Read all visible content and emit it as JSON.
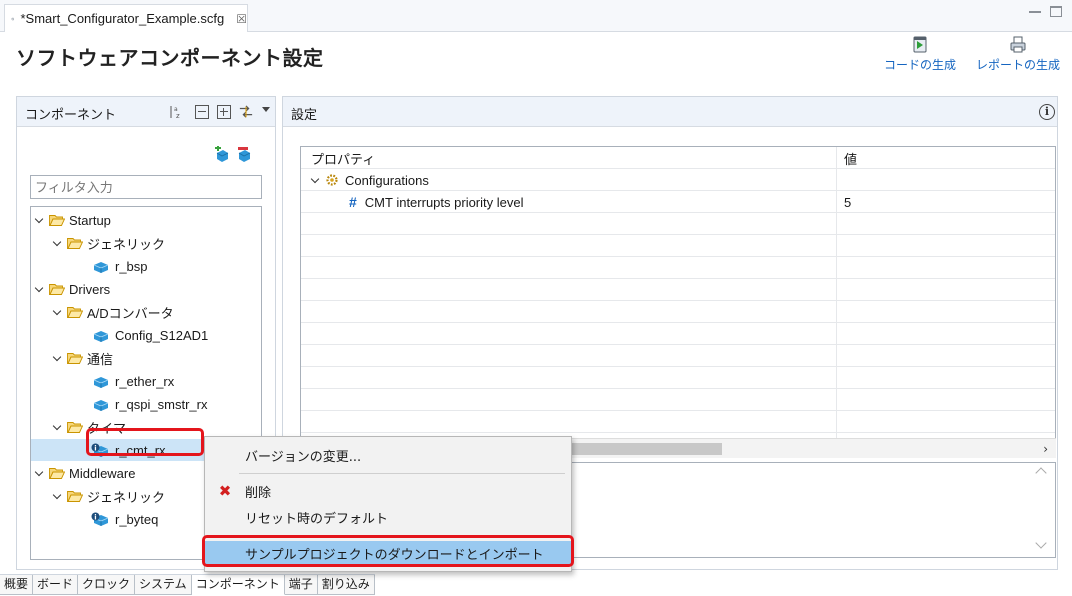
{
  "editor_tab": {
    "label": "*Smart_Configurator_Example.scfg",
    "close": "☒"
  },
  "page_title": "ソフトウェアコンポーネント設定",
  "header_buttons": {
    "code_gen": "コードの生成",
    "report_gen": "レポートの生成"
  },
  "left_pane": {
    "title": "コンポーネント",
    "filter_placeholder": "フィルタ入力",
    "tree": [
      {
        "label": "Startup",
        "kind": "folder",
        "level": 0
      },
      {
        "label": "ジェネリック",
        "kind": "folder",
        "level": 1
      },
      {
        "label": "r_bsp",
        "kind": "component",
        "level": 2
      },
      {
        "label": "Drivers",
        "kind": "folder",
        "level": 0
      },
      {
        "label": "A/Dコンバータ",
        "kind": "folder",
        "level": 1
      },
      {
        "label": "Config_S12AD1",
        "kind": "component",
        "level": 2
      },
      {
        "label": "通信",
        "kind": "folder",
        "level": 1
      },
      {
        "label": "r_ether_rx",
        "kind": "component",
        "level": 2
      },
      {
        "label": "r_qspi_smstr_rx",
        "kind": "component",
        "level": 2
      },
      {
        "label": "タイマ",
        "kind": "folder",
        "level": 1
      },
      {
        "label": "r_cmt_rx",
        "kind": "component",
        "level": 2,
        "selected": true
      },
      {
        "label": "Middleware",
        "kind": "folder",
        "level": 0
      },
      {
        "label": "ジェネリック",
        "kind": "folder",
        "level": 1
      },
      {
        "label": "r_byteq",
        "kind": "component",
        "level": 2
      }
    ]
  },
  "right_pane": {
    "title": "設定",
    "table": {
      "col_property": "プロパティ",
      "col_value": "値",
      "group": "Configurations",
      "rows": [
        {
          "property": "CMT interrupts priority level",
          "value": "5"
        }
      ]
    },
    "scroll_right": "›"
  },
  "context_menu": {
    "items": [
      {
        "label": "バージョンの変更..."
      },
      {
        "label": "削除"
      },
      {
        "label": "リセット時のデフォルト"
      },
      {
        "label": "サンプルプロジェクトのダウンロードとインポート"
      }
    ]
  },
  "bottom_tabs": [
    "概要",
    "ボード",
    "クロック",
    "システム",
    "コンポーネント",
    "端子",
    "割り込み"
  ],
  "colors": {
    "link": "#1565c0",
    "selection": "#cce4f7",
    "menu_highlight": "#99c9f0",
    "callout": "#e4151c",
    "folder": "#f0b400",
    "component": "#2196f3"
  }
}
